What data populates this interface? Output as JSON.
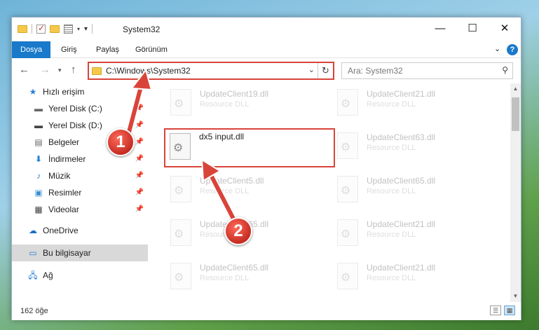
{
  "window": {
    "title": "System32",
    "controls": {
      "minimize": "—",
      "maximize": "☐",
      "close": "✕"
    }
  },
  "ribbon": {
    "tabs": [
      {
        "label": "Dosya",
        "active": true
      },
      {
        "label": "Giriş"
      },
      {
        "label": "Paylaş"
      },
      {
        "label": "Görünüm"
      }
    ],
    "help": "?"
  },
  "nav": {
    "address": "C:\\Windows\\System32",
    "search_placeholder": "Ara: System32"
  },
  "sidebar": {
    "items": [
      {
        "label": "Hızlı erişim",
        "icon": "star-icon"
      },
      {
        "label": "Yerel Disk (C:)",
        "icon": "drive-icon",
        "pinned": true
      },
      {
        "label": "Yerel Disk (D:)",
        "icon": "drive-icon",
        "pinned": true
      },
      {
        "label": "Belgeler",
        "icon": "documents-icon",
        "pinned": true
      },
      {
        "label": "İndirmeler",
        "icon": "download-icon",
        "pinned": true
      },
      {
        "label": "Müzik",
        "icon": "music-icon",
        "pinned": true
      },
      {
        "label": "Resimler",
        "icon": "pictures-icon",
        "pinned": true
      },
      {
        "label": "Videolar",
        "icon": "videos-icon",
        "pinned": true
      },
      {
        "label": "OneDrive",
        "icon": "cloud-icon"
      },
      {
        "label": "Bu bilgisayar",
        "icon": "computer-icon",
        "selected": true
      },
      {
        "label": "Ağ",
        "icon": "network-icon"
      }
    ]
  },
  "files": [
    {
      "name": "UpdateClient19.dll",
      "type": "Resource DLL"
    },
    {
      "name": "UpdateClient21.dll",
      "type": "Resource DLL"
    },
    {
      "name": "dx5 input.dll",
      "type": ""
    },
    {
      "name": "UpdateClient63.dll",
      "type": "Resource DLL"
    },
    {
      "name": "UpdateClient5.dll",
      "type": "Resource DLL"
    },
    {
      "name": "UpdateClient65.dll",
      "type": "Resource DLL"
    },
    {
      "name": "UpdateClient65.dll",
      "type": "Resource DLL"
    },
    {
      "name": "UpdateClient21.dll",
      "type": "Resource DLL"
    },
    {
      "name": "UpdateClient65.dll",
      "type": "Resource DLL"
    },
    {
      "name": "UpdateClient21.dll",
      "type": "Resource DLL"
    }
  ],
  "status": {
    "count": "162 öğe"
  },
  "annotations": {
    "badge1": "1",
    "badge2": "2",
    "color": "#d9443a"
  }
}
